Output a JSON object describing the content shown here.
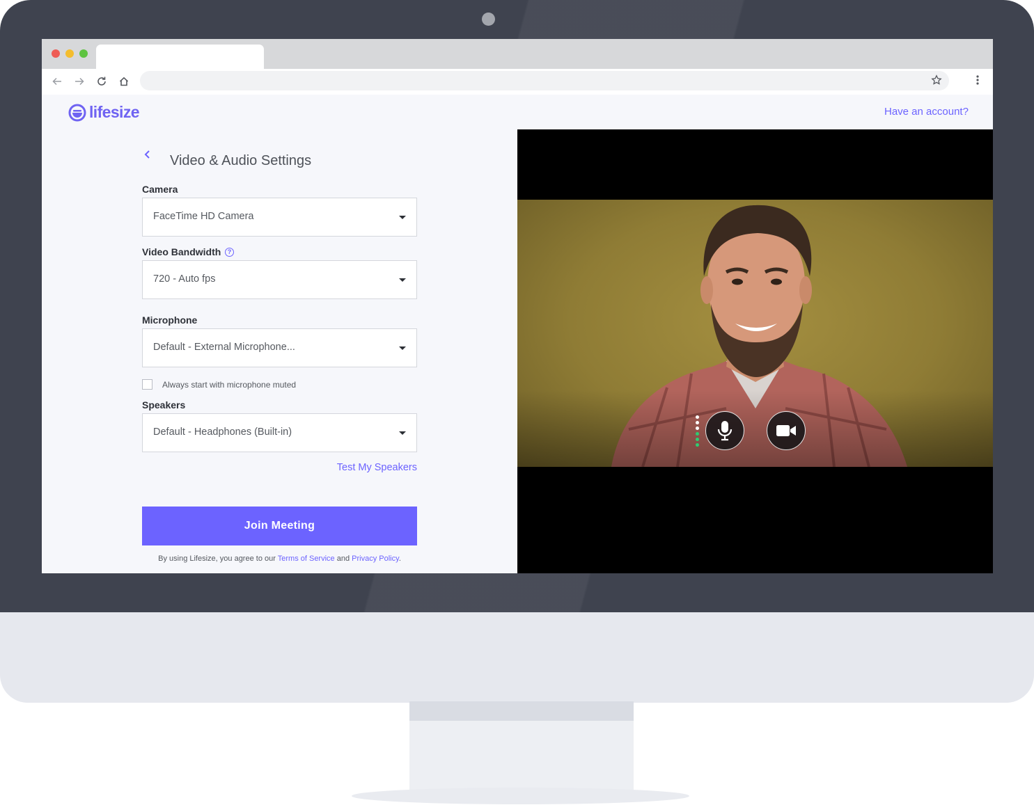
{
  "header": {
    "logo_text": "lifesize",
    "have_account_link": "Have an account?"
  },
  "settings": {
    "title": "Video & Audio Settings",
    "camera": {
      "label": "Camera",
      "selected": "FaceTime HD Camera"
    },
    "video_bandwidth": {
      "label": "Video Bandwidth",
      "help_icon": "?",
      "selected": "720 - Auto fps"
    },
    "microphone": {
      "label": "Microphone",
      "selected": "Default - External Microphone..."
    },
    "mute_checkbox": {
      "label": "Always start with microphone muted",
      "checked": false
    },
    "speakers": {
      "label": "Speakers",
      "selected": "Default - Headphones (Built-in)"
    },
    "test_speakers_link": "Test My Speakers",
    "join_button": "Join Meeting",
    "terms": {
      "prefix": "By using Lifesize, you agree to our",
      "tos_link": "Terms of Service",
      "and": "and",
      "privacy_link": "Privacy Policy",
      "suffix": "."
    }
  },
  "video_preview": {
    "mic_level_active": 3,
    "mic_level_total": 6,
    "controls": [
      "microphone-icon",
      "video-camera-icon"
    ]
  },
  "colors": {
    "accent": "#6c63ff",
    "level_active": "#2ecc71",
    "frame": "#3f434f"
  }
}
